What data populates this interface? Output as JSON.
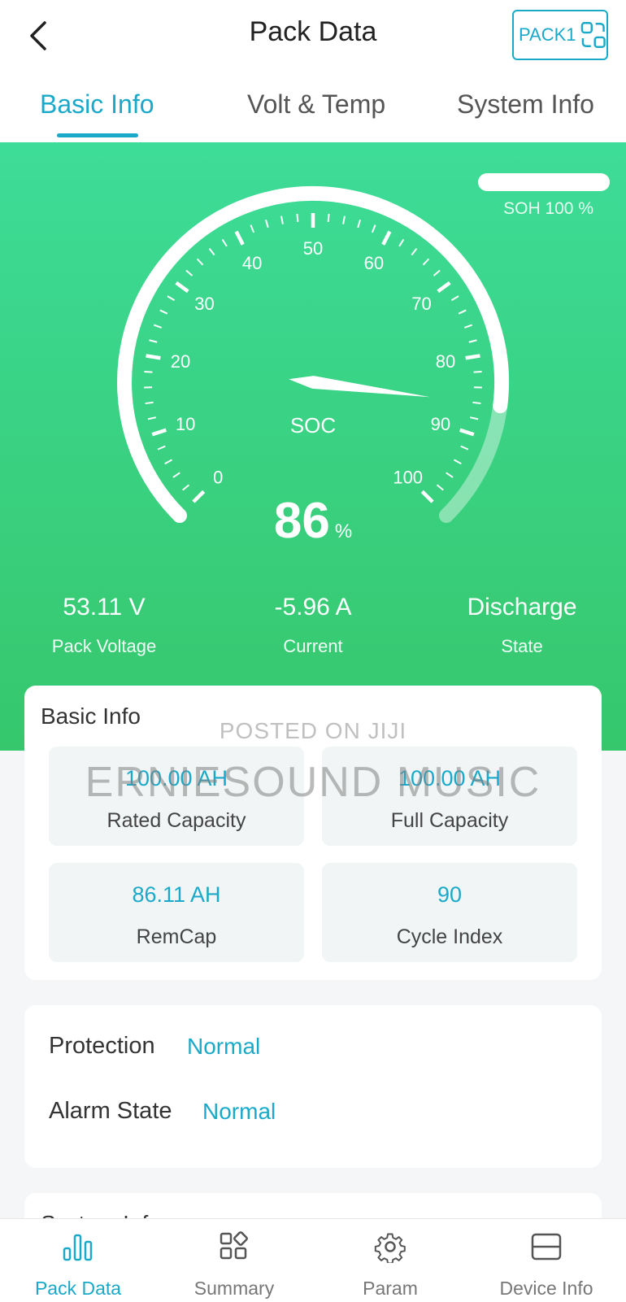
{
  "header": {
    "title": "Pack Data",
    "pack_label": "PACK1",
    "tabs": [
      "Basic Info",
      "Volt & Temp",
      "System Info"
    ],
    "active_tab": 0
  },
  "gauge": {
    "soh_label": "SOH 100 %",
    "soh_value": 1.0,
    "center_label": "SOC",
    "soc_value": "86",
    "soc_unit": "%",
    "soc_fraction": 0.86,
    "ticks": [
      "0",
      "10",
      "20",
      "30",
      "40",
      "50",
      "60",
      "70",
      "80",
      "90",
      "100"
    ]
  },
  "stats": [
    {
      "value": "53.11 V",
      "label": "Pack Voltage"
    },
    {
      "value": "-5.96 A",
      "label": "Current"
    },
    {
      "value": "Discharge",
      "label": "State"
    }
  ],
  "basic_info": {
    "title": "Basic Info",
    "tiles": [
      {
        "value": "100.00 AH",
        "label": "Rated Capacity"
      },
      {
        "value": "100.00 AH",
        "label": "Full Capacity"
      },
      {
        "value": "86.11 AH",
        "label": "RemCap"
      },
      {
        "value": "90",
        "label": "Cycle Index"
      }
    ]
  },
  "watermark": {
    "line1": "POSTED ON JIJI",
    "line2": "ERNIESOUND MUSIC"
  },
  "protection": {
    "protection_label": "Protection",
    "protection_value": "Normal",
    "alarm_label": "Alarm State",
    "alarm_value": "Normal"
  },
  "system_info": {
    "title": "System Info"
  },
  "bottom_nav": [
    {
      "label": "Pack Data",
      "icon": "bar-chart-icon",
      "active": true
    },
    {
      "label": "Summary",
      "icon": "grid-icon",
      "active": false
    },
    {
      "label": "Param",
      "icon": "gear-icon",
      "active": false
    },
    {
      "label": "Device Info",
      "icon": "device-icon",
      "active": false
    }
  ],
  "colors": {
    "accent": "#1aa9c9",
    "hero_top": "#3ddc98",
    "hero_bottom": "#36c76c"
  }
}
